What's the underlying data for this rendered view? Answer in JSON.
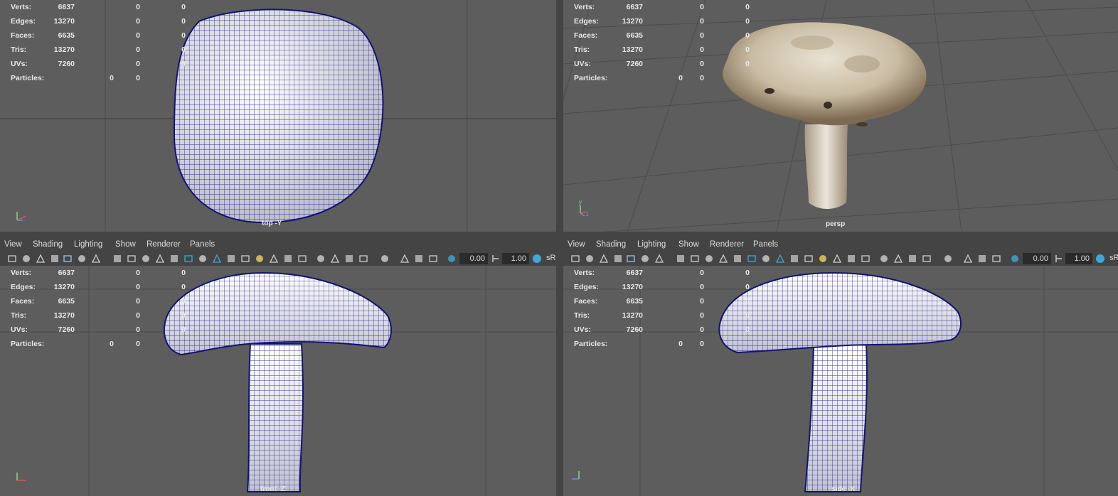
{
  "stats": {
    "labels": [
      "Verts:",
      "Edges:",
      "Faces:",
      "Tris:",
      "UVs:",
      "Particles:"
    ],
    "values": [
      [
        "6637",
        "0",
        "0"
      ],
      [
        "13270",
        "0",
        "0"
      ],
      [
        "6635",
        "0",
        "0"
      ],
      [
        "13270",
        "0",
        "0"
      ],
      [
        "7260",
        "0",
        "0"
      ],
      [
        "0",
        "0"
      ]
    ]
  },
  "viewports": {
    "top": "top -Y",
    "persp": "persp",
    "front": "front -Z",
    "side": "side -X"
  },
  "menu": [
    "View",
    "Shading",
    "Lighting",
    "Show",
    "Renderer",
    "Panels"
  ],
  "toolbar": {
    "exposure": "0.00",
    "gamma": "1.00",
    "colorspace": "sR"
  },
  "axis_labels": {
    "x": "x",
    "y": "y",
    "z": "z"
  },
  "icons": [
    "camera-select-icon",
    "camera-attributes-icon",
    "bookmark-icon",
    "image-plane-icon",
    "grid-icon",
    "film-gate-icon",
    "resolution-gate-icon",
    "gate-mask-icon",
    "field-chart-icon",
    "safe-action-icon",
    "safe-title-icon",
    "wireframe-icon",
    "smooth-shade-icon",
    "default-material-icon",
    "wireframe-on-shaded-icon",
    "xray-icon",
    "textured-icon",
    "use-all-lights-icon",
    "shadows-icon",
    "screen-space-ao-icon",
    "motion-blur-icon",
    "multisample-aa-icon",
    "depth-of-field-icon",
    "isolate-select-icon",
    "xray-active-icon",
    "xray-joints-icon",
    "backface-culling-icon",
    "exposure-icon",
    "gamma-icon",
    "color-management-icon"
  ],
  "colors": {
    "viewport_bg": "#5d5d5d",
    "wire": "#1a1a8c",
    "panel": "#444444"
  }
}
